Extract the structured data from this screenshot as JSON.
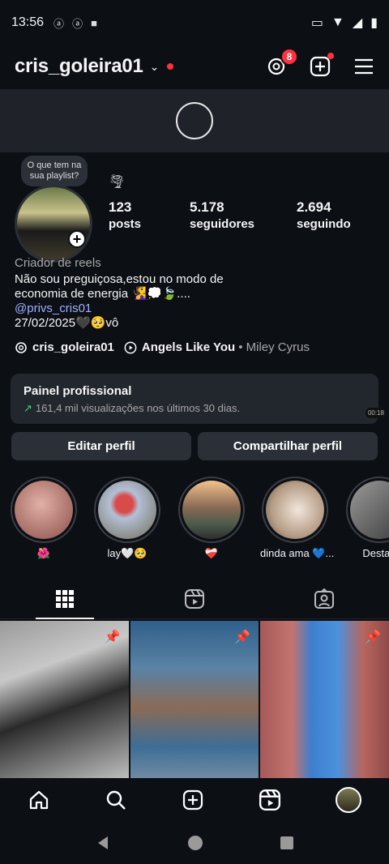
{
  "status": {
    "time": "13:56"
  },
  "header": {
    "username": "cris_goleira01",
    "notif_count": "8"
  },
  "profile": {
    "note": "O que tem na sua playlist?",
    "stats": [
      {
        "num": "123",
        "label": "posts"
      },
      {
        "num": "5.178",
        "label": "seguidores"
      },
      {
        "num": "2.694",
        "label": "seguindo"
      }
    ],
    "role": "Criador de reels",
    "bio_line1": "Não sou preguiçosa,estou no modo de",
    "bio_line2": "economia de energia 🧏‍♀️💭🍃....",
    "link": "@privs_cris01",
    "date_line": "27/02/2025🖤🥺vô",
    "threads_user": "cris_goleira01",
    "song": "Angels Like You",
    "artist": "• Miley Cyrus"
  },
  "panel": {
    "title": "Painel profissional",
    "subtitle": "161,4 mil visualizações nos últimos 30 dias.",
    "time_tag": "00:18"
  },
  "buttons": {
    "edit": "Editar perfil",
    "share": "Compartilhar perfil"
  },
  "highlights": [
    {
      "label": "🌺",
      "color": "#c98b84"
    },
    {
      "label": "lay🤍🥺",
      "color": "#a39f86"
    },
    {
      "label": "❤️‍🩹",
      "color": "#c7a08d"
    },
    {
      "label": "dinda ama 💙...",
      "color": "#d9ccc0"
    },
    {
      "label": "Destaq",
      "color": "#6a6a6a"
    }
  ]
}
